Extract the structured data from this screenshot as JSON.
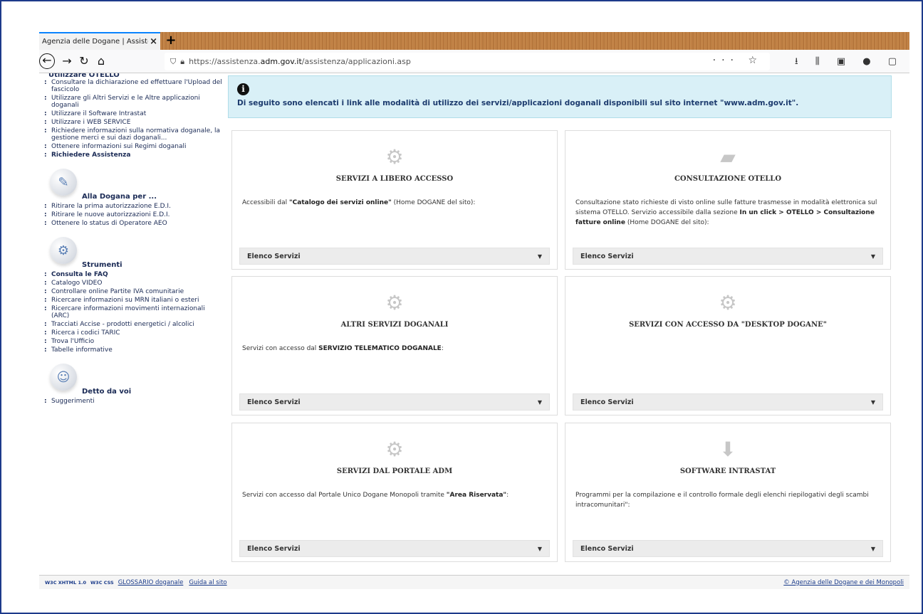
{
  "browser": {
    "tab_title": "Agenzia delle Dogane | Assistenza",
    "tab_close": "×",
    "new_tab": "+",
    "url_scheme": "https://assistenza.",
    "url_host": "adm.gov.it",
    "url_path": "/assistenza/applicazioni.asp",
    "url_actions": "··· ☆",
    "toolbar_icons": "⭳ ⫼ ▣ ● ▢"
  },
  "sidebar": {
    "top_heading": "Utilizzare OTELLO",
    "group1": [
      "Consultare la dichiarazione ed effettuare l'Upload del fascicolo",
      "Utilizzare gli Altri Servizi e le Altre applicazioni doganali",
      "Utilizzare il Software Intrastat",
      "Utilizzare i WEB SERVICE",
      "Richiedere informazioni sulla normativa doganale, la gestione merci e sui dazi doganali...",
      "Ottenere informazioni sui Regimi doganali",
      "Richiedere Assistenza"
    ],
    "section2_title": "Alla Dogana per ...",
    "group2": [
      "Ritirare la prima autorizzazione E.D.I.",
      "Ritirare le nuove autorizzazioni E.D.I.",
      "Ottenere lo status di Operatore AEO"
    ],
    "section3_title": "Strumenti",
    "group3": [
      "Consulta le FAQ",
      "Catalogo VIDEO",
      "Controllare online Partite IVA comunitarie",
      "Ricercare informazioni su MRN italiani o esteri",
      "Ricercare informazioni movimenti internazionali (ARC)",
      "Tracciati Accise - prodotti energetici / alcolici",
      "Ricerca i codici TARIC",
      "Trova l'Ufficio",
      "Tabelle informative"
    ],
    "section4_title": "Detto da voi",
    "group4": [
      "Suggerimenti"
    ]
  },
  "alert": {
    "icon": "i",
    "text": "Di seguito sono elencati i link alle modalità di utilizzo dei servizi/applicazioni doganali disponibili sul sito internet \"www.adm.gov.it\"."
  },
  "cards": [
    {
      "title": "SERVIZI A LIBERO ACCESSO",
      "desc_pre": "Accessibili dal ",
      "desc_bold": "\"Catalogo dei servizi online\"",
      "desc_post": " (Home DOGANE del sito):",
      "select": "Elenco Servizi",
      "icon": "gear-icon"
    },
    {
      "title": "CONSULTAZIONE OTELLO",
      "desc_pre": "Consultazione stato richieste di visto online sulle fatture trasmesse in modalità elettronica sul sistema OTELLO. Servizio accessibile dalla sezione ",
      "desc_bold": "In un click > OTELLO > Consultazione fatture online",
      "desc_post": " (Home DOGANE del sito):",
      "select": "Elenco Servizi",
      "icon": "book-icon"
    },
    {
      "title": "ALTRI SERVIZI DOGANALI",
      "desc_pre": "Servizi con accesso dal ",
      "desc_bold": "SERVIZIO TELEMATICO DOGANALE",
      "desc_post": ":",
      "select": "Elenco Servizi",
      "icon": "gear-icon"
    },
    {
      "title": "SERVIZI CON ACCESSO DA \"DESKTOP DOGANE\"",
      "desc_pre": "",
      "desc_bold": "",
      "desc_post": "",
      "select": "Elenco Servizi",
      "icon": "gear-icon"
    },
    {
      "title": "SERVIZI DAL PORTALE ADM",
      "desc_pre": "Servizi con accesso dal Portale Unico Dogane Monopoli tramite ",
      "desc_bold": "\"Area Riservata\"",
      "desc_post": ":",
      "select": "Elenco Servizi",
      "icon": "gear-icon"
    },
    {
      "title": "SOFTWARE INTRASTAT",
      "desc_pre": "Programmi per la compilazione e il controllo formale degli elenchi riepilogativi degli scambi intracomunitari\":",
      "desc_bold": "",
      "desc_post": "",
      "select": "Elenco Servizi",
      "icon": "download-icon"
    }
  ],
  "footer": {
    "w3c_xhtml": "W3C XHTML 1.0",
    "w3c_css": "W3C CSS",
    "glossario": "GLOSSARIO doganale",
    "guida": "Guida al sito",
    "copyright": "© Agenzia delle Dogane e dei Monopoli"
  },
  "colors": {
    "frame_border": "#1d3a8a",
    "link_blue": "#1a2a55",
    "alert_bg": "#d9f0f7",
    "alert_text": "#1c3b6e"
  }
}
